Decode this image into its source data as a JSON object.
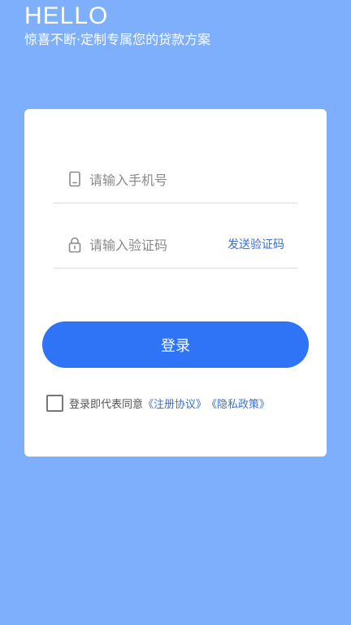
{
  "hero": {
    "title": "HELLO",
    "subtitle": "惊喜不断·定制专属您的贷款方案"
  },
  "form": {
    "phone_placeholder": "请输入手机号",
    "code_placeholder": "请输入验证码",
    "send_code_label": "发送验证码",
    "login_label": "登录"
  },
  "agreement": {
    "prefix": "登录即代表同意",
    "register_link": "《注册协议》",
    "privacy_link": "《隐私政策》",
    "checked": false
  },
  "colors": {
    "background": "#7eaffd",
    "primary": "#2f74f6",
    "link": "#3b6fd0"
  },
  "icons": {
    "phone": "phone-icon",
    "lock": "lock-icon"
  }
}
